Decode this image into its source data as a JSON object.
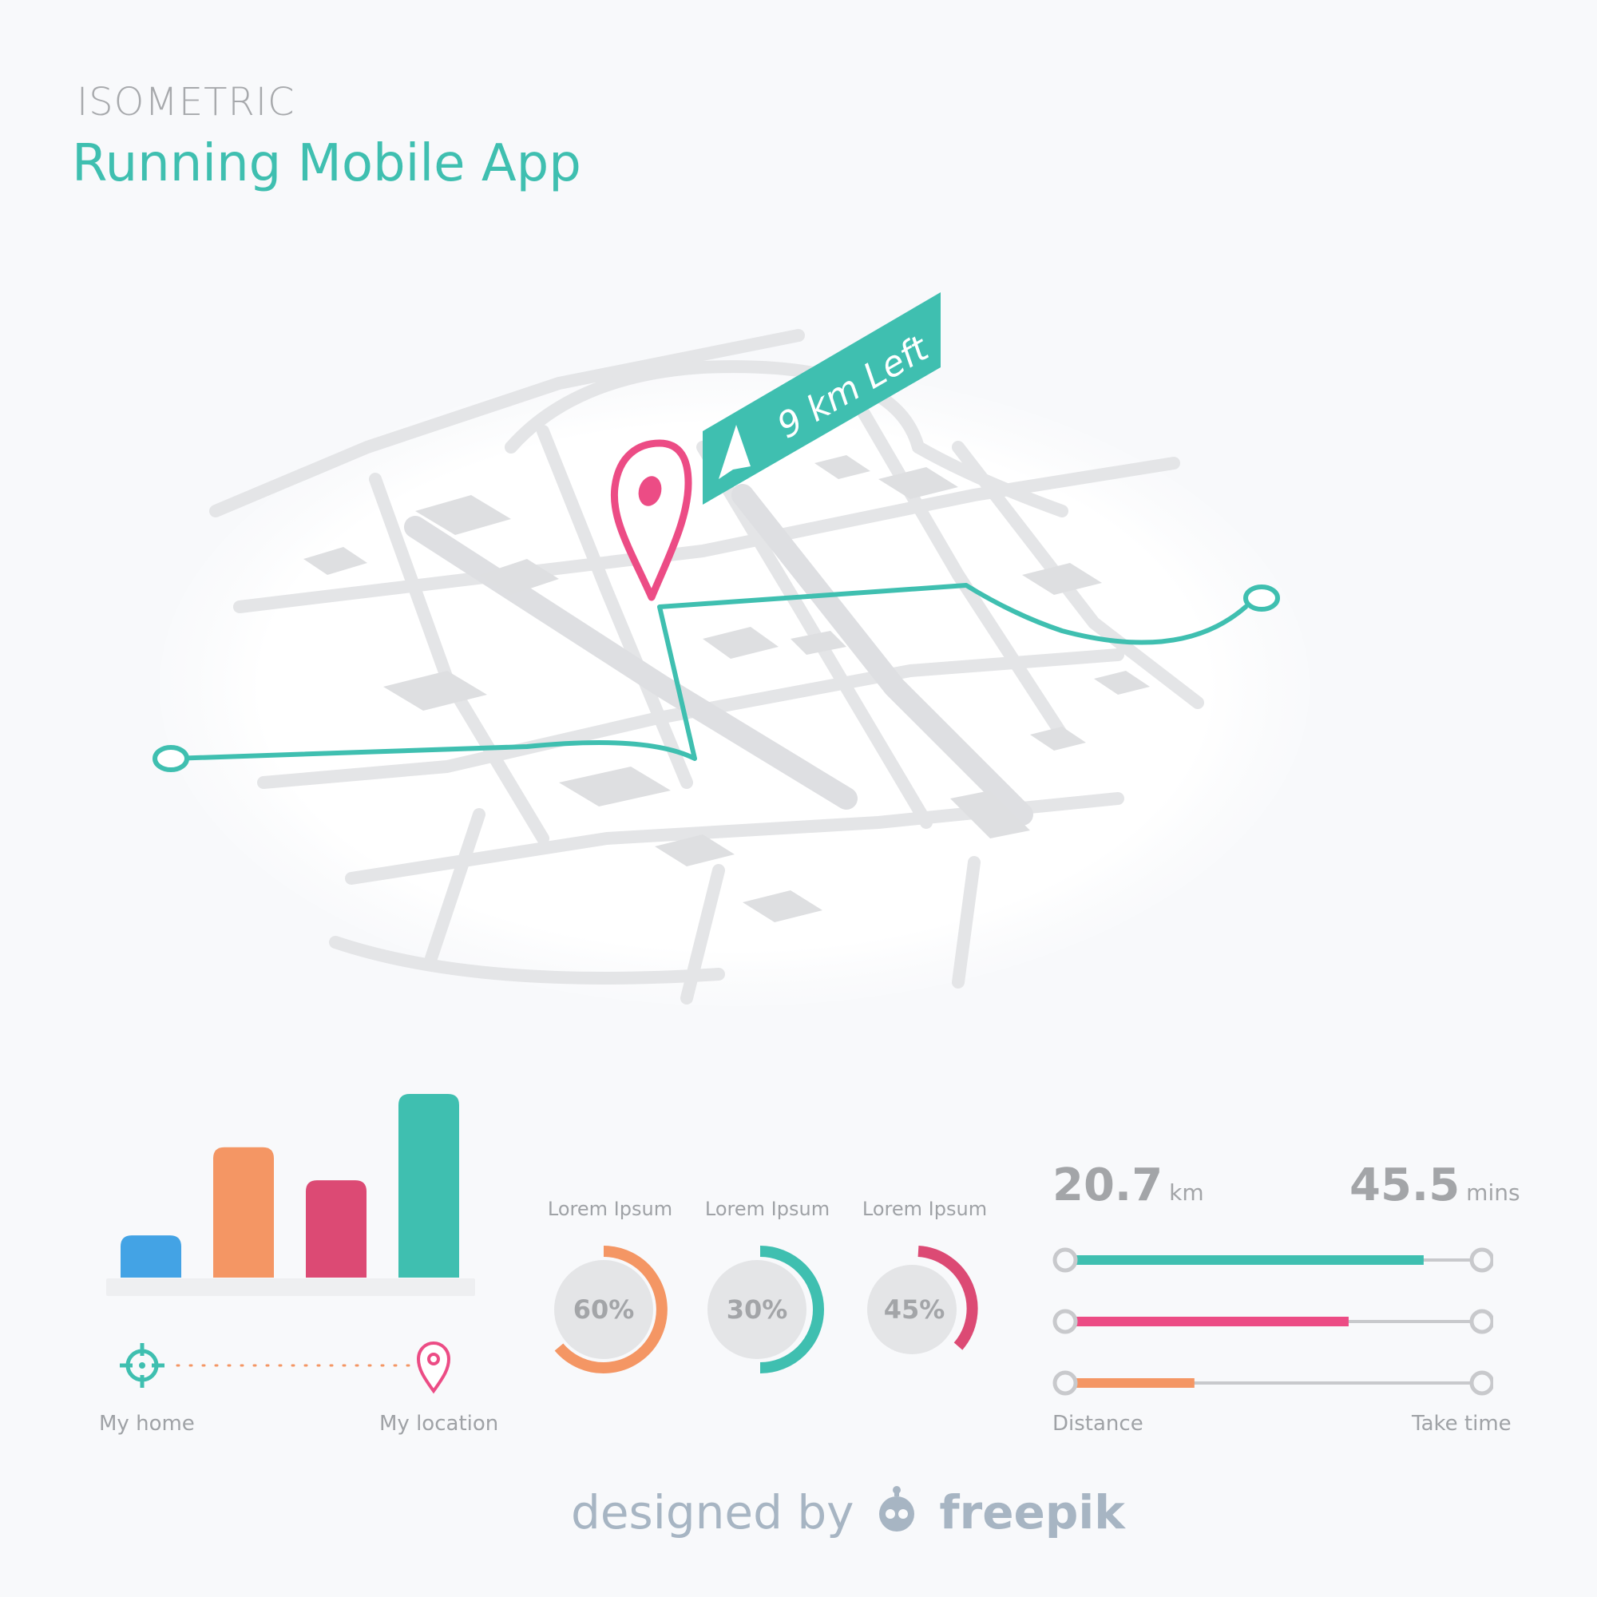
{
  "header": {
    "subtitle": "ISOMETRIC",
    "title": "Running Mobile App"
  },
  "map": {
    "banner_text": "9 km Left",
    "icons": {
      "pin": "location-pin-icon",
      "arrow": "navigation-arrow-icon"
    },
    "colors": {
      "route": "#3fbfb0",
      "pin": "#ec4c85",
      "street": "#e5e6e8"
    }
  },
  "bar_chart": {
    "values": [
      0.23,
      0.71,
      0.53,
      1.0
    ],
    "colors": [
      "#43a3e5",
      "#f49664",
      "#dc4a74",
      "#3fbfb0"
    ]
  },
  "route_legend": {
    "start_label": "My home",
    "end_label": "My location",
    "start_icon": "crosshair-icon",
    "end_icon": "location-pin-icon"
  },
  "donuts": [
    {
      "label": "Lorem Ipsum",
      "value_text": "60%",
      "color": "#f49664"
    },
    {
      "label": "Lorem Ipsum",
      "value_text": "30%",
      "color": "#3fbfb0"
    },
    {
      "label": "Lorem Ipsum",
      "value_text": "45%",
      "color": "#dc4a74"
    }
  ],
  "stats": {
    "distance_value": "20.7",
    "distance_unit": "km",
    "time_value": "45.5",
    "time_unit": "mins",
    "distance_label": "Distance",
    "time_label": "Take time"
  },
  "sliders": [
    {
      "progress": 0.86,
      "color": "#3fbfb0"
    },
    {
      "progress": 0.68,
      "color": "#ec4c85"
    },
    {
      "progress": 0.31,
      "color": "#f49664"
    }
  ],
  "footer": {
    "prefix": "designed by",
    "brand": "freepik",
    "logo_icon": "freepik-robot-icon"
  }
}
